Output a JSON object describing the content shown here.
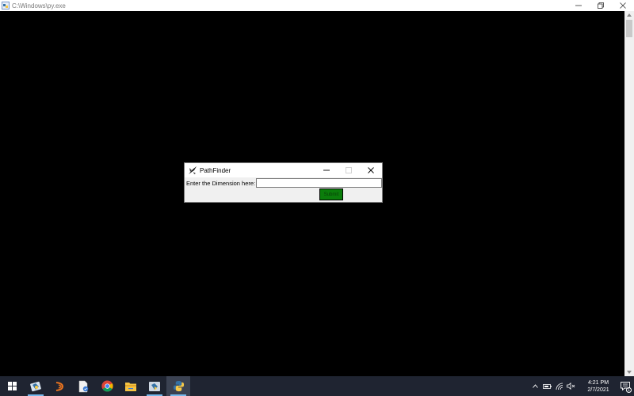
{
  "console": {
    "title": "C:\\Windows\\py.exe",
    "icon": "python-console-icon"
  },
  "dialog": {
    "title": "PathFinder",
    "icon": "tk-feather-icon",
    "dimension_label": "Enter the Dimension here:",
    "dimension_value": "",
    "submit_label": "Submit",
    "submit_color": "#0b7d0b"
  },
  "taskbar": {
    "apps": [
      {
        "name": "start",
        "icon": "windows-logo-icon"
      },
      {
        "name": "python-idle",
        "icon": "python-idle-icon"
      },
      {
        "name": "eclipse",
        "icon": "eclipse-icon"
      },
      {
        "name": "document",
        "icon": "document-icon"
      },
      {
        "name": "chrome",
        "icon": "chrome-icon"
      },
      {
        "name": "file-explorer",
        "icon": "folder-icon"
      },
      {
        "name": "python-launcher",
        "icon": "python-launcher-icon"
      },
      {
        "name": "python",
        "icon": "python-icon"
      }
    ],
    "time": "4:21 PM",
    "date": "2/7/2021",
    "notification_count": "1",
    "accent": "#76b9ed"
  }
}
